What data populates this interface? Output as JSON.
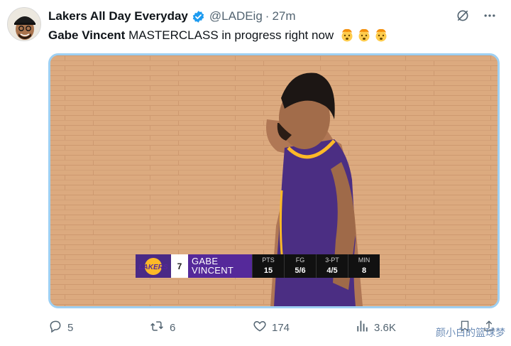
{
  "tweet": {
    "display_name": "Lakers All Day Everyday",
    "handle": "@LADEig",
    "separator": "·",
    "time": "27m",
    "text_bold": "Gabe Vincent",
    "text_rest": " MASTERCLASS in progress right now",
    "emojis": [
      "exploding-head-emoji",
      "exploding-head-emoji",
      "exploding-head-emoji"
    ]
  },
  "scorebug": {
    "logo_text": "LAKERS",
    "jersey_number": "7",
    "first_name": "GABE",
    "last_name": "VINCENT",
    "stats": [
      {
        "label": "PTS",
        "value": "15"
      },
      {
        "label": "FG",
        "value": "5/6"
      },
      {
        "label": "3-PT",
        "value": "4/5"
      },
      {
        "label": "MIN",
        "value": "8"
      }
    ]
  },
  "actions": {
    "replies": "5",
    "reposts": "6",
    "likes": "174",
    "views": "3.6K"
  },
  "watermark": "颜小白的篮球梦",
  "icons": {
    "verified": "verified-badge-icon",
    "grok": "grok-icon",
    "more": "more-icon",
    "reply": "reply-icon",
    "repost": "repost-icon",
    "like": "like-icon",
    "views": "views-icon",
    "bookmark": "bookmark-icon",
    "share": "share-icon"
  },
  "colors": {
    "verified_blue": "#1d9bf0",
    "text_secondary": "#536471",
    "lakers_purple": "#55299a",
    "lakers_gold": "#fdb927"
  }
}
